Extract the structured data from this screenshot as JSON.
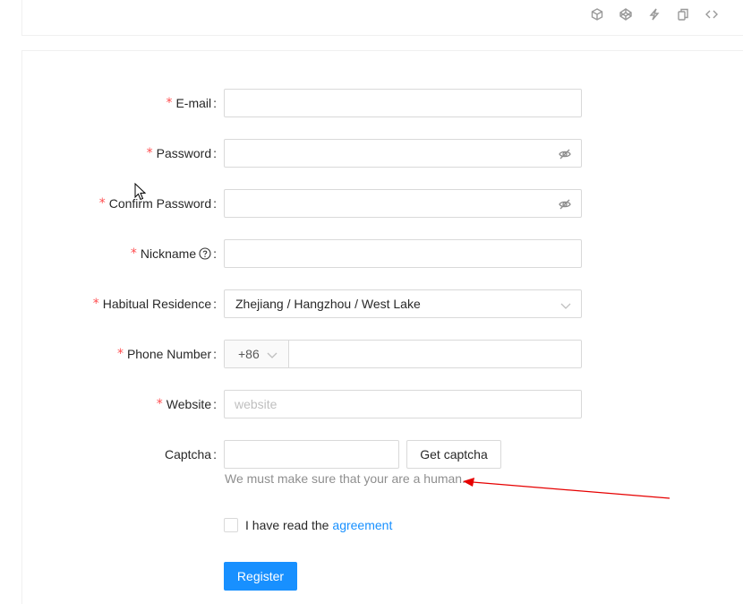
{
  "toolbar": {
    "icons": [
      "codesandbox-icon",
      "codepen-icon",
      "thunderbolt-icon",
      "copy-icon",
      "code-icon"
    ]
  },
  "form": {
    "email": {
      "label": "E-mail",
      "value": "",
      "placeholder": ""
    },
    "password": {
      "label": "Password",
      "value": "",
      "placeholder": ""
    },
    "confirm": {
      "label": "Confirm Password",
      "value": "",
      "placeholder": ""
    },
    "nickname": {
      "label": "Nickname",
      "value": "",
      "placeholder": ""
    },
    "residence": {
      "label": "Habitual Residence",
      "value": "Zhejiang / Hangzhou / West Lake"
    },
    "phone": {
      "label": "Phone Number",
      "prefix": "+86",
      "value": "",
      "placeholder": ""
    },
    "website": {
      "label": "Website",
      "value": "",
      "placeholder": "website"
    },
    "captcha": {
      "label": "Captcha",
      "value": "",
      "button": "Get captcha",
      "help": "We must make sure that your are a human."
    },
    "agreement": {
      "text": "I have read the",
      "link": "agreement",
      "checked": false
    },
    "register": "Register"
  },
  "colors": {
    "primary": "#1890ff",
    "required": "#ff4d4f",
    "annotation": "#e60000"
  }
}
